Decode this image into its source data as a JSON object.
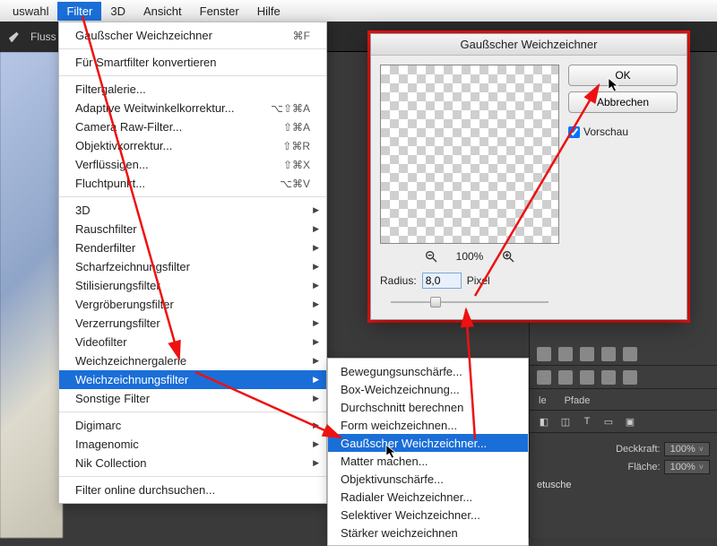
{
  "menubar": {
    "items": [
      "uswahl",
      "Filter",
      "3D",
      "Ansicht",
      "Fenster",
      "Hilfe"
    ],
    "active_index": 1
  },
  "toolbar": {
    "label": "Fluss"
  },
  "filter_menu": {
    "recent": {
      "label": "Gaußscher Weichzeichner",
      "shortcut": "⌘F"
    },
    "smart": "Für Smartfilter konvertieren",
    "group2": [
      {
        "label": "Filtergalerie..."
      },
      {
        "label": "Adaptive Weitwinkelkorrektur...",
        "shortcut": "⌥⇧⌘A"
      },
      {
        "label": "Camera Raw-Filter...",
        "shortcut": "⇧⌘A"
      },
      {
        "label": "Objektivkorrektur...",
        "shortcut": "⇧⌘R"
      },
      {
        "label": "Verflüssigen...",
        "shortcut": "⇧⌘X"
      },
      {
        "label": "Fluchtpunkt...",
        "shortcut": "⌥⌘V"
      }
    ],
    "group3": [
      "3D",
      "Rauschfilter",
      "Renderfilter",
      "Scharfzeichnungsfilter",
      "Stilisierungsfilter",
      "Vergröberungsfilter",
      "Verzerrungsfilter",
      "Videofilter",
      "Weichzeichnergalerie",
      "Weichzeichnungsfilter",
      "Sonstige Filter"
    ],
    "group3_highlight": 9,
    "group4": [
      "Digimarc",
      "Imagenomic",
      "Nik Collection"
    ],
    "browse": "Filter online durchsuchen..."
  },
  "submenu": {
    "items": [
      "Bewegungsunschärfe...",
      "Box-Weichzeichnung...",
      "Durchschnitt berechnen",
      "Form weichzeichnen...",
      "Gaußscher Weichzeichner...",
      "Matter machen...",
      "Objektivunschärfe...",
      "Radialer Weichzeichner...",
      "Selektiver Weichzeichner...",
      "Stärker weichzeichnen"
    ],
    "highlight": 4
  },
  "dialog": {
    "title": "Gaußscher Weichzeichner",
    "ok": "OK",
    "cancel": "Abbrechen",
    "preview_label": "Vorschau",
    "preview_checked": true,
    "zoom": "100%",
    "radius_label": "Radius:",
    "radius_value": "8,0",
    "radius_unit": "Pixel"
  },
  "right_panel": {
    "tabs1": [
      "le",
      "Pfade"
    ],
    "opacity_label": "Deckkraft:",
    "opacity_value": "100%",
    "fill_label": "Fläche:",
    "fill_value": "100%",
    "layer_name": "etusche"
  }
}
